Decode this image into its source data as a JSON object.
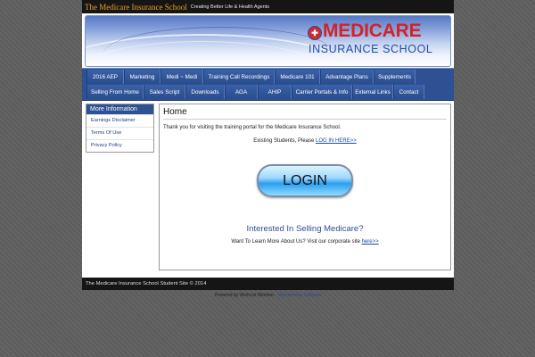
{
  "header": {
    "site_title": "The Medicare Insurance School",
    "tagline": "Creating Better Life & Health Agents"
  },
  "banner": {
    "logo_main": "MEDICARE",
    "logo_sub": "INSURANCE SCHOOL",
    "logo_icon": "medical-cross-icon"
  },
  "nav": {
    "row1": [
      "2016 AEP",
      "Marketing",
      "Medi ~ Medi",
      "Training Call Recordings",
      "Medicare 101",
      "Advantage Plans",
      "Supplements"
    ],
    "row2": [
      "Selling From Home",
      "Sales Script",
      "Downloads",
      "AGA",
      "AHIP",
      "Carrier Portals & Info",
      "External Links",
      "Contact"
    ]
  },
  "sidebar": {
    "heading": "More Information",
    "items": [
      "Earnings Disclaimer",
      "Terms Of Use",
      "Privacy Policy"
    ]
  },
  "main": {
    "heading": "Home",
    "thanks_text": "Thank you for visiting the training portal for the Medicare Insurance School.",
    "existing_prefix": "Existing Students, Please ",
    "existing_link": "LOG IN HERE>>",
    "login_button": "LOGIN",
    "interested_heading": "Interested In Selling Medicare?",
    "learn_prefix": "Want To Learn More About Us?  Visit our corporate site ",
    "learn_link": "here>>"
  },
  "footer": {
    "copyright": "The Medicare Insurance School Student Site © 2014",
    "powered_prefix": "Powered by WishList Member - ",
    "powered_link": "Membership Software"
  },
  "colors": {
    "accent_orange": "#f0a020",
    "nav_blue": "#2d5193",
    "logo_red": "#d12328",
    "logo_blue": "#1f4ea3"
  }
}
